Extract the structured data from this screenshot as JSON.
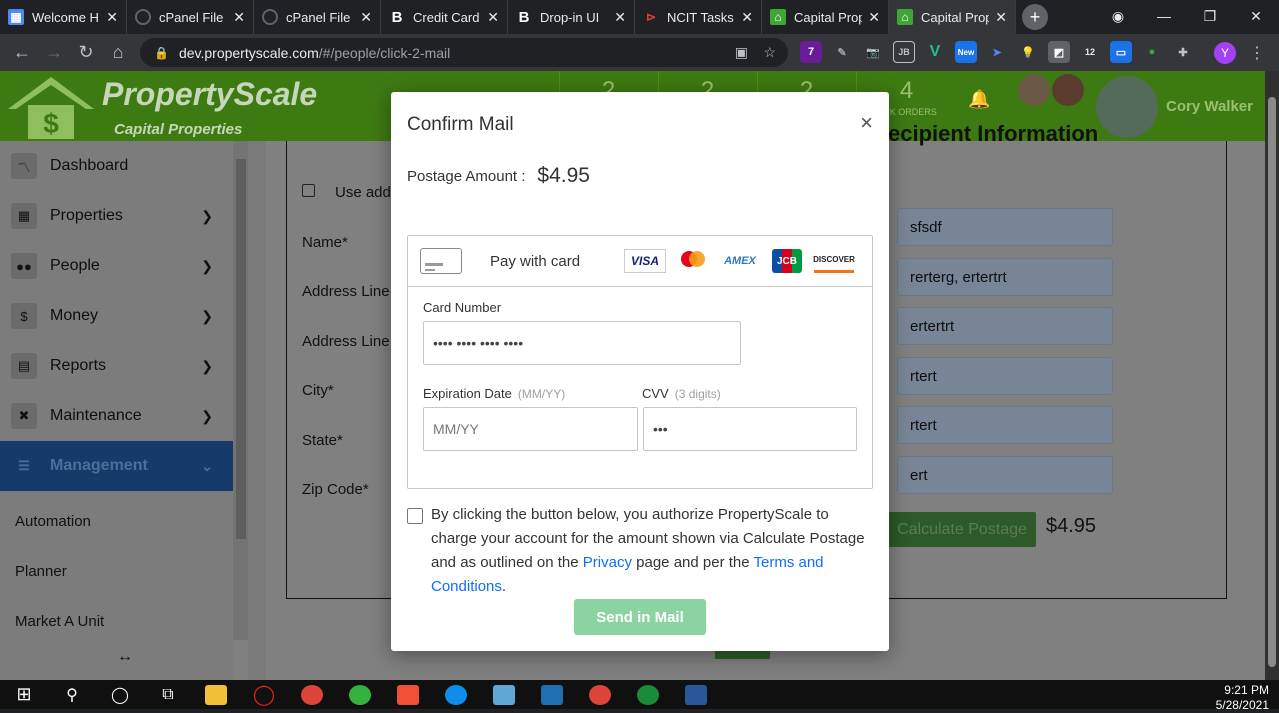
{
  "browser": {
    "tabs": [
      {
        "title": "Welcome H",
        "favicon": "grid-icon",
        "color": "#4a8af4",
        "active": false
      },
      {
        "title": "cPanel File M",
        "favicon": "cpanel-icon",
        "color": "#5f6368",
        "active": false
      },
      {
        "title": "cPanel File M",
        "favicon": "cpanel-icon",
        "color": "#5f6368",
        "active": false
      },
      {
        "title": "Credit Card",
        "favicon": "B",
        "color": "#ffffff",
        "active": false
      },
      {
        "title": "Drop-in UI",
        "favicon": "B",
        "color": "#ffffff",
        "active": false
      },
      {
        "title": "NCIT Tasks",
        "favicon": "tasks-icon",
        "color": "#e53935",
        "active": false
      },
      {
        "title": "Capital Prop",
        "favicon": "house-icon",
        "color": "#3fa535",
        "active": false
      },
      {
        "title": "Capital Prop",
        "favicon": "house-icon",
        "color": "#3fa535",
        "active": true
      }
    ],
    "new_tab": "+",
    "url_host": "dev.propertyscale.com",
    "url_path": "/#/people/click-2-mail",
    "ext_badges": {
      "purple": "7",
      "new": "New",
      "count": "12"
    },
    "profile_initial": "Y"
  },
  "app": {
    "brand": "PropertyScale",
    "sub_brand": "Capital Properties",
    "header_stats": [
      {
        "value": "2",
        "label": ""
      },
      {
        "value": "2",
        "label": ""
      },
      {
        "value": "2",
        "label": ""
      },
      {
        "value": "4",
        "label": "ORK ORDERS"
      }
    ],
    "user_name": "Cory Walker"
  },
  "sidebar": {
    "items": [
      {
        "label": "Dashboard",
        "icon": "chart-icon",
        "glyph": "📈",
        "chevron": false
      },
      {
        "label": "Properties",
        "icon": "building-icon",
        "glyph": "▦",
        "chevron": true
      },
      {
        "label": "People",
        "icon": "users-icon",
        "glyph": "👥",
        "chevron": true
      },
      {
        "label": "Money",
        "icon": "dollar-icon",
        "glyph": "$",
        "chevron": true
      },
      {
        "label": "Reports",
        "icon": "printer-icon",
        "glyph": "🖶",
        "chevron": true
      },
      {
        "label": "Maintenance",
        "icon": "tools-icon",
        "glyph": "✖",
        "chevron": true
      },
      {
        "label": "Management",
        "icon": "list-icon",
        "glyph": "☰",
        "chevron": true,
        "active": true
      }
    ],
    "subitems": [
      "Automation",
      "Planner",
      "Market A Unit"
    ]
  },
  "form": {
    "checkbox_label": "Use add",
    "section_title": "ecipient Information",
    "labels": [
      "Name*",
      "Address Line",
      "Address Line",
      "City*",
      "State*",
      "Zip Code*"
    ],
    "recipient_values": [
      "sfsdf",
      "rerterg, ertertrt",
      "ertertrt",
      "rtert",
      "rtert",
      "ert"
    ],
    "calc_button": "Calculate Postage",
    "calc_amount": "$4.95"
  },
  "modal": {
    "title": "Confirm Mail",
    "close": "×",
    "postage_label": "Postage Amount :",
    "postage_amount": "$4.95",
    "pay_with_card": "Pay with card",
    "brands": [
      "VISA",
      "mastercard",
      "AMEX",
      "JCB",
      "DISCOVER"
    ],
    "card_number_label": "Card Number",
    "card_number_value": "•••• •••• •••• ••••",
    "expiry_label": "Expiration Date",
    "expiry_hint": "(MM/YY)",
    "expiry_placeholder": "MM/YY",
    "cvv_label": "CVV",
    "cvv_hint": "(3 digits)",
    "cvv_value": "•••",
    "legal_1": "By clicking the button below, you authorize PropertyScale to charge your account for the amount shown via Calculate Postage and as outlined on the ",
    "privacy_link": "Privacy",
    "legal_2": " page and per the ",
    "terms_link": "Terms and Conditions",
    "legal_3": ".",
    "send_button": "Send in Mail"
  },
  "taskbar": {
    "time": "9:21 PM",
    "date": "5/28/2021"
  }
}
